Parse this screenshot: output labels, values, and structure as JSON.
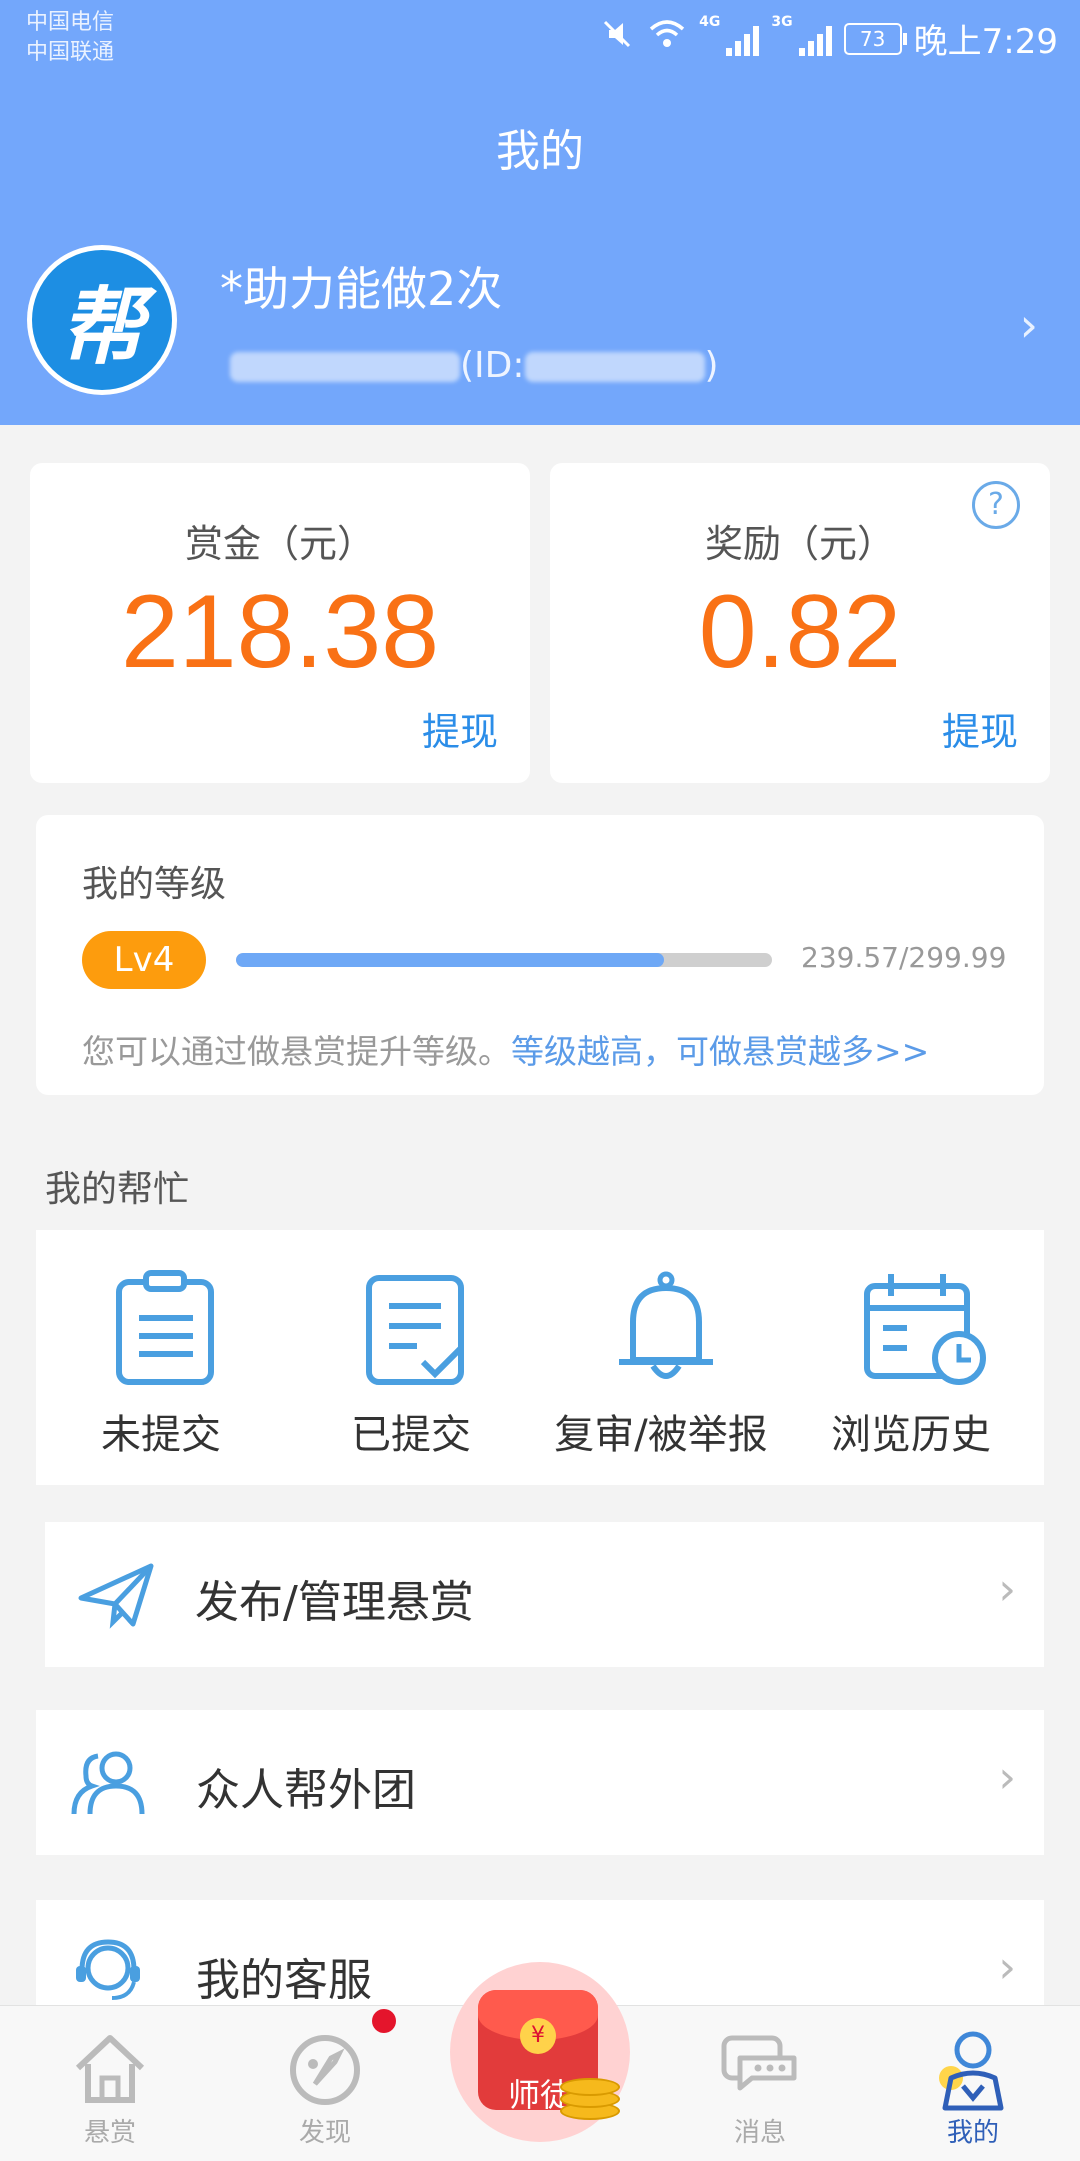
{
  "status_bar": {
    "carrier_1": "中国电信",
    "carrier_2": "中国联通",
    "net_1": "4G",
    "net_2": "3G",
    "battery": "73",
    "time": "晚上7:29"
  },
  "header": {
    "title": "我的",
    "avatar_text": "帮",
    "user_name": "*助力能做2次",
    "user_id_prefix": "(ID:",
    "user_id_suffix": ")"
  },
  "balance": {
    "bounty_label": "赏金（元）",
    "bounty_value": "218.38",
    "bounty_action": "提现",
    "reward_label": "奖励（元）",
    "reward_value": "0.82",
    "reward_action": "提现",
    "help_symbol": "?"
  },
  "level": {
    "title": "我的等级",
    "badge": "Lv4",
    "progress_text": "239.57/299.99",
    "progress_fraction": 0.799,
    "tip": "您可以通过做悬赏提升等级。",
    "link": "等级越高，可做悬赏越多>>"
  },
  "my_help": {
    "title": "我的帮忙",
    "items": [
      {
        "label": "未提交",
        "icon": "clipboard-icon"
      },
      {
        "label": "已提交",
        "icon": "checked-document-icon"
      },
      {
        "label": "复审/被举报",
        "icon": "bell-icon"
      },
      {
        "label": "浏览历史",
        "icon": "calendar-clock-icon"
      }
    ]
  },
  "rows": [
    {
      "label": "发布/管理悬赏",
      "icon": "paper-plane-icon"
    },
    {
      "label": "众人帮外团",
      "icon": "people-icon"
    },
    {
      "label": "我的客服",
      "icon": "customer-service-icon"
    }
  ],
  "tabbar": {
    "tabs": [
      {
        "label": "悬赏",
        "icon": "home-icon"
      },
      {
        "label": "发现",
        "icon": "discover-icon"
      },
      {
        "label": "师徒",
        "icon": "red-envelope-icon"
      },
      {
        "label": "消息",
        "icon": "message-icon"
      },
      {
        "label": "我的",
        "icon": "profile-icon"
      }
    ],
    "active": "我的"
  },
  "colors": {
    "header_bg": "#73a7fb",
    "amount": "#f97115",
    "link": "#2b8de8",
    "level_badge": "#fd9c0d",
    "icon": "#4a9fe0",
    "active_tab": "#2f5fb8"
  }
}
